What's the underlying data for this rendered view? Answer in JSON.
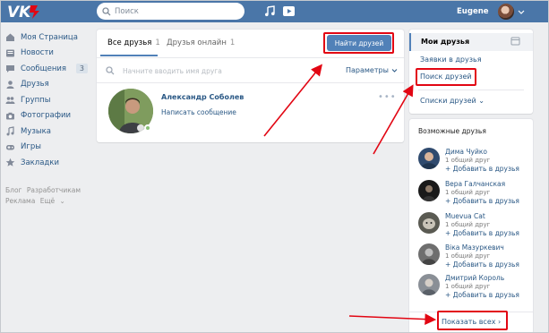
{
  "header": {
    "logo_text": "VK",
    "search_placeholder": "Поиск",
    "username": "Eugene"
  },
  "leftnav": {
    "items": [
      {
        "label": "Моя Страница",
        "icon": "home-icon"
      },
      {
        "label": "Новости",
        "icon": "news-icon"
      },
      {
        "label": "Сообщения",
        "icon": "messages-icon",
        "badge": "3"
      },
      {
        "label": "Друзья",
        "icon": "friends-icon"
      },
      {
        "label": "Группы",
        "icon": "groups-icon"
      },
      {
        "label": "Фотографии",
        "icon": "camera-icon"
      },
      {
        "label": "Музыка",
        "icon": "music-icon"
      },
      {
        "label": "Игры",
        "icon": "games-icon"
      },
      {
        "label": "Закладки",
        "icon": "star-icon"
      }
    ],
    "footer": [
      "Блог",
      "Разработчикам",
      "Реклама",
      "Ещё"
    ]
  },
  "main": {
    "tabs": [
      {
        "label": "Все друзья",
        "count": "1"
      },
      {
        "label": "Друзья онлайн",
        "count": "1"
      }
    ],
    "find_button": "Найти друзей",
    "friend_search_placeholder": "Начните вводить имя друга",
    "params_label": "Параметры",
    "friends": [
      {
        "name": "Александр Соболев",
        "action": "Написать сообщение"
      }
    ]
  },
  "rightmenu": {
    "items": [
      "Мои друзья",
      "Заявки в друзья",
      "Поиск друзей",
      "Списки друзей"
    ]
  },
  "possible_friends": {
    "title": "Возможные друзья",
    "items": [
      {
        "name": "Дима Чуйко",
        "common": "1 общий друг",
        "add": "+ Добавить в друзья"
      },
      {
        "name": "Вера Галчанская",
        "common": "1 общий друг",
        "add": "+ Добавить в друзья"
      },
      {
        "name": "Muevua Cat",
        "common": "1 общий друг",
        "add": "+ Добавить в друзья"
      },
      {
        "name": "Віка Мазуркевич",
        "common": "1 общий друг",
        "add": "+ Добавить в друзья"
      },
      {
        "name": "Дмитрий Король",
        "common": "1 общий друг",
        "add": "+ Добавить в друзья"
      }
    ],
    "show_all": "Показать всех"
  },
  "colors": {
    "header_bg": "#4a76a8",
    "link": "#2a5885",
    "button_bg": "#5181b8",
    "highlight": "#e20613",
    "page_bg": "#edeef0"
  }
}
